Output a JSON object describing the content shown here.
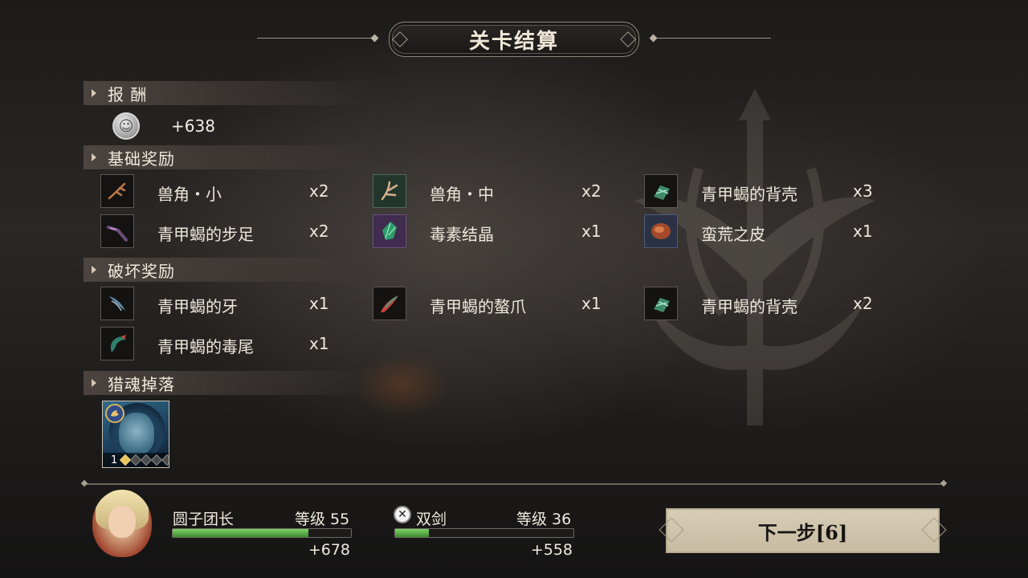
{
  "title": "关卡结算",
  "sections": {
    "reward": "报 酬",
    "basic": "基础奖励",
    "destroy": "破坏奖励",
    "soul": "猎魂掉落"
  },
  "reward": {
    "coin_value": "+638",
    "coin_icon": "silver-coin-icon"
  },
  "basic_items": [
    {
      "name": "兽角・小",
      "qty": "x2",
      "icon": "small-horn-icon"
    },
    {
      "name": "兽角・中",
      "qty": "x2",
      "icon": "medium-horn-icon"
    },
    {
      "name": "青甲蝎的背壳",
      "qty": "x3",
      "icon": "scorpion-carapace-icon"
    },
    {
      "name": "青甲蝎的步足",
      "qty": "x2",
      "icon": "scorpion-leg-icon"
    },
    {
      "name": "毒素结晶",
      "qty": "x1",
      "icon": "toxin-crystal-icon"
    },
    {
      "name": "蛮荒之皮",
      "qty": "x1",
      "icon": "wild-hide-icon"
    }
  ],
  "destroy_items": [
    {
      "name": "青甲蝎的牙",
      "qty": "x1",
      "icon": "scorpion-fang-icon"
    },
    {
      "name": "青甲蝎的螯爪",
      "qty": "x1",
      "icon": "scorpion-claw-icon"
    },
    {
      "name": "青甲蝎的背壳",
      "qty": "x2",
      "icon": "scorpion-carapace-icon"
    },
    {
      "name": "青甲蝎的毒尾",
      "qty": "x1",
      "icon": "scorpion-tail-icon"
    }
  ],
  "soul_card": {
    "level": "1",
    "stars_filled": 1,
    "stars_total": 5
  },
  "player": {
    "name": "圆子团长",
    "level": "等级 55",
    "xp_gain": "+678",
    "xp_progress": 0.76
  },
  "weapon": {
    "name": "双剑",
    "level": "等级 36",
    "xp_gain": "+558",
    "xp_progress": 0.19,
    "icon": "crossed-swords-icon"
  },
  "next_button": "下一步[6]",
  "colors": {
    "xp_fill": "#5fb84a",
    "button_bg": "#cfc4ab",
    "accent_text": "#f0e9dc"
  }
}
